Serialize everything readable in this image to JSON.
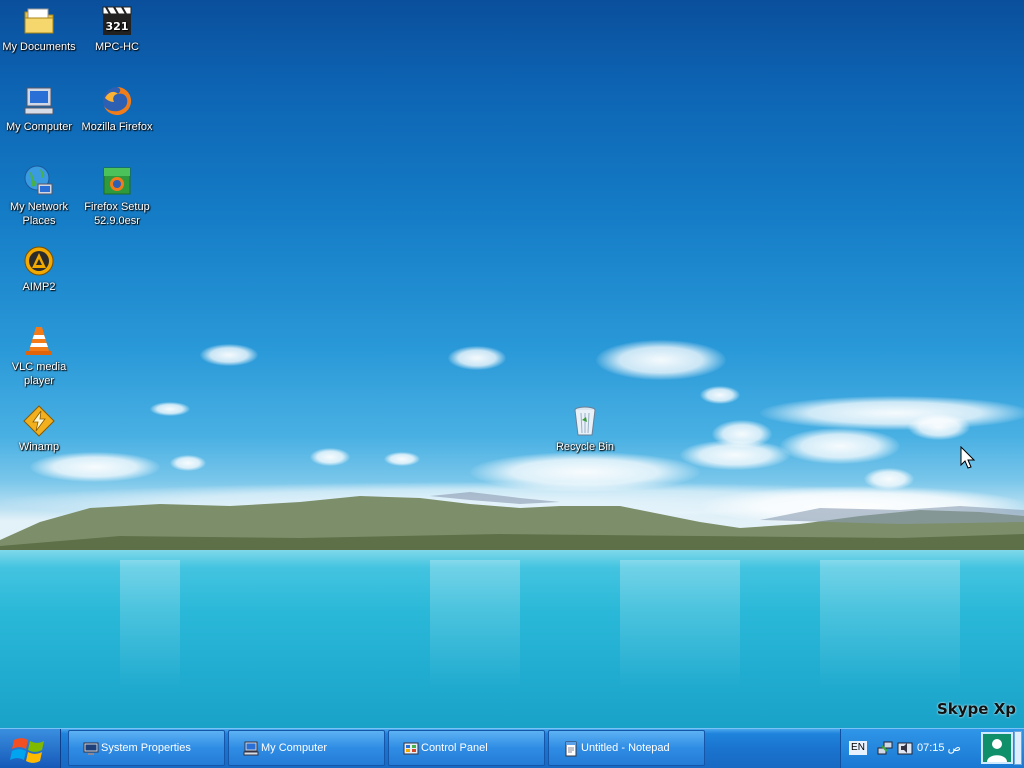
{
  "desktop": {
    "icons": [
      {
        "label": "My Documents",
        "icon": "folder-icon"
      },
      {
        "label": "MPC-HC",
        "icon": "clapperboard-icon"
      },
      {
        "label": "My Computer",
        "icon": "computer-icon"
      },
      {
        "label": "Mozilla Firefox",
        "icon": "firefox-icon"
      },
      {
        "label": "My Network Places",
        "icon": "network-globe-icon"
      },
      {
        "label": "Firefox Setup 52.9.0esr",
        "icon": "installer-box-icon"
      },
      {
        "label": "AIMP2",
        "icon": "aimp-icon"
      },
      {
        "label": "VLC media player",
        "icon": "traffic-cone-icon"
      },
      {
        "label": "Winamp",
        "icon": "lightning-icon"
      },
      {
        "label": "Recycle Bin",
        "icon": "recycle-bin-icon"
      }
    ],
    "brand": "Skype Xp"
  },
  "taskbar": {
    "start_icon": "windows-logo-icon",
    "tasks": [
      {
        "label": "System Properties",
        "icon": "monitor-icon"
      },
      {
        "label": "My Computer",
        "icon": "computer-icon"
      },
      {
        "label": "Control Panel",
        "icon": "control-panel-icon"
      },
      {
        "label": "Untitled - Notepad",
        "icon": "notepad-icon"
      }
    ],
    "tray": {
      "language": "EN",
      "clock": "07:15 ص",
      "icons": [
        "network-tray-icon",
        "speaker-tray-icon",
        "user-avatar-icon"
      ]
    }
  },
  "colors": {
    "sky_top": "#0a4f9c",
    "lake": "#2ab8d8",
    "taskbar": "#1a74cf"
  }
}
